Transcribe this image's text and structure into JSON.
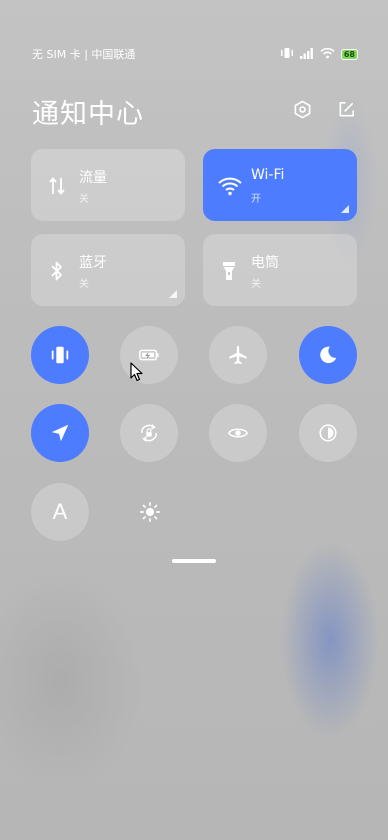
{
  "status_bar": {
    "carrier": "无 SIM 卡 | 中国联通",
    "battery": "68"
  },
  "header": {
    "title": "通知中心"
  },
  "tiles": [
    {
      "label": "流量",
      "state": "关",
      "icon": "data-transfer-icon"
    },
    {
      "label": "Wi-Fi",
      "state": "开",
      "icon": "wifi-icon"
    },
    {
      "label": "蓝牙",
      "state": "关",
      "icon": "bluetooth-icon"
    },
    {
      "label": "电筒",
      "state": "关",
      "icon": "flashlight-icon"
    }
  ],
  "toggles": [
    {
      "icon": "vibrate-icon",
      "on": true
    },
    {
      "icon": "battery-saver-icon",
      "on": false
    },
    {
      "icon": "airplane-icon",
      "on": false
    },
    {
      "icon": "moon-icon",
      "on": true
    },
    {
      "icon": "location-icon",
      "on": true
    },
    {
      "icon": "rotation-lock-icon",
      "on": false
    },
    {
      "icon": "eye-icon",
      "on": false
    },
    {
      "icon": "contrast-icon",
      "on": false
    },
    {
      "icon": "auto-brightness-icon",
      "on": false,
      "glyph": "A"
    },
    {
      "icon": "brightness-icon",
      "on": false
    }
  ],
  "colors": {
    "accent": "#4d7cff",
    "tile_off": "rgba(255,255,255,0.22)"
  }
}
